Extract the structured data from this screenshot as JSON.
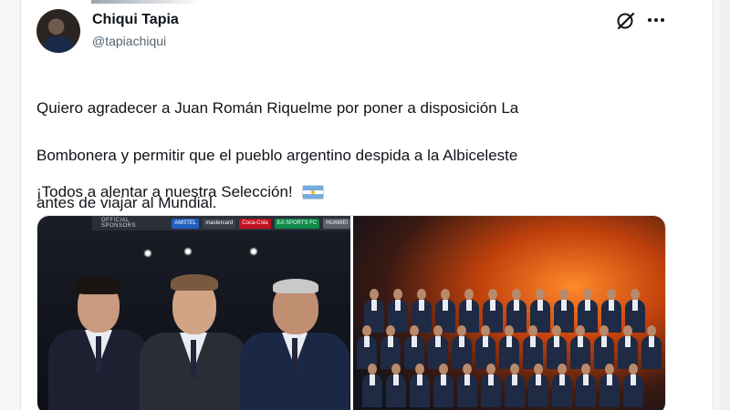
{
  "post": {
    "display_name": "Chiqui Tapia",
    "handle": "@tapiachiqui",
    "text_lines": [
      "Quiero agradecer a Juan Román Riquelme por poner a disposición La",
      "Bombonera y permitir que el pueblo argentino despida a la Albiceleste",
      "antes de viajar al Mundial."
    ],
    "cheer": "¡Todos a alentar a nuestra Selección!",
    "cheer_emoji": "argentina-flag-icon"
  },
  "header_icons": {
    "grok": "grok-icon",
    "more": "more-icon"
  },
  "media": {
    "left_sponsor_title": "OFFICIAL SPONSORS",
    "left_sponsor_logos": [
      "AMSTEL",
      "mastercard",
      "Coca-Cola",
      "EA SPORTS FC",
      "HUAWEI"
    ]
  },
  "colors": {
    "text": "#0f1419",
    "secondary": "#536471",
    "border": "#dfe3e7",
    "flag_blue": "#74acdf",
    "flag_sun": "#f6b40e"
  }
}
